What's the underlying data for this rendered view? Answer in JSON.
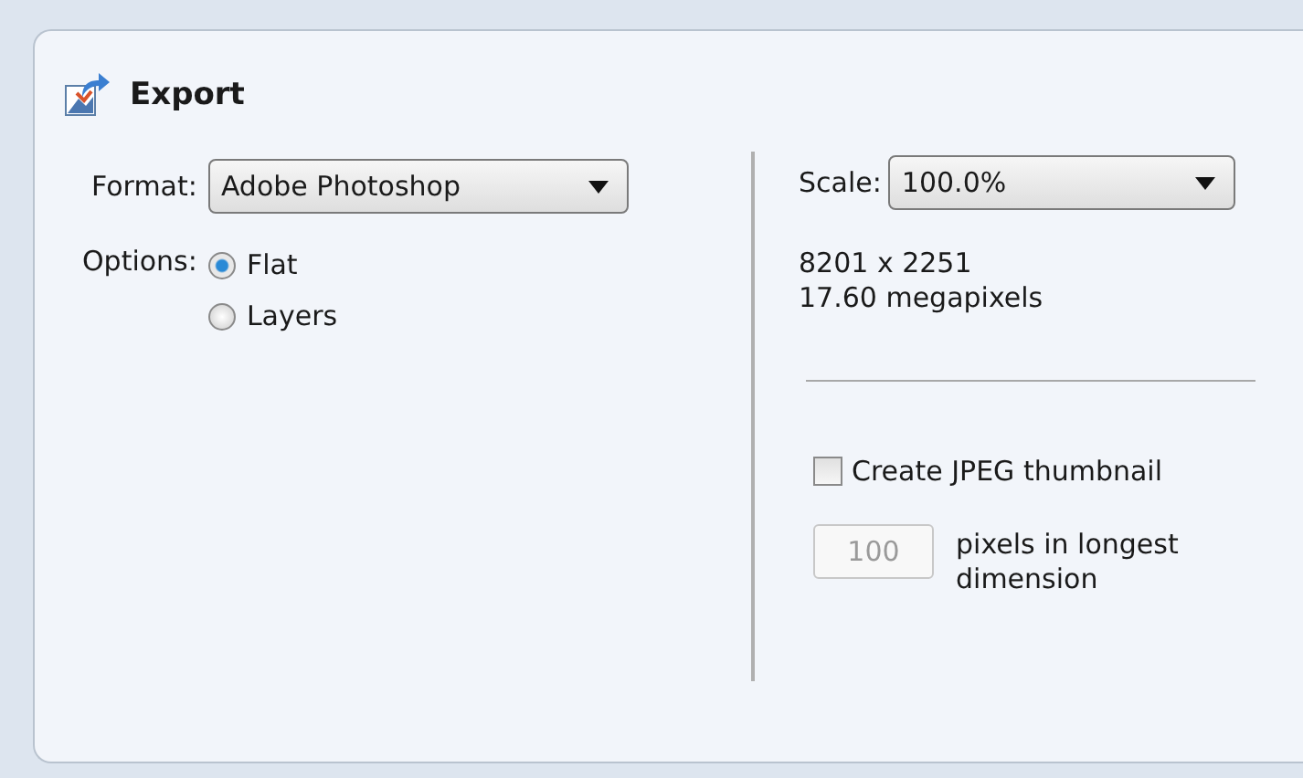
{
  "panel": {
    "title": "Export"
  },
  "format": {
    "label": "Format:",
    "value": "Adobe Photoshop"
  },
  "options": {
    "label": "Options:",
    "items": [
      {
        "label": "Flat",
        "selected": true
      },
      {
        "label": "Layers",
        "selected": false
      }
    ]
  },
  "scale": {
    "label": "Scale:",
    "value": "100.0%"
  },
  "size_info": [
    "8201 x 2251",
    "17.60 megapixels"
  ],
  "thumbnail": {
    "label": "Create JPEG thumbnail",
    "checked": false,
    "size": {
      "value": "100",
      "disabled": true,
      "label": "pixels in longest dimension"
    }
  }
}
